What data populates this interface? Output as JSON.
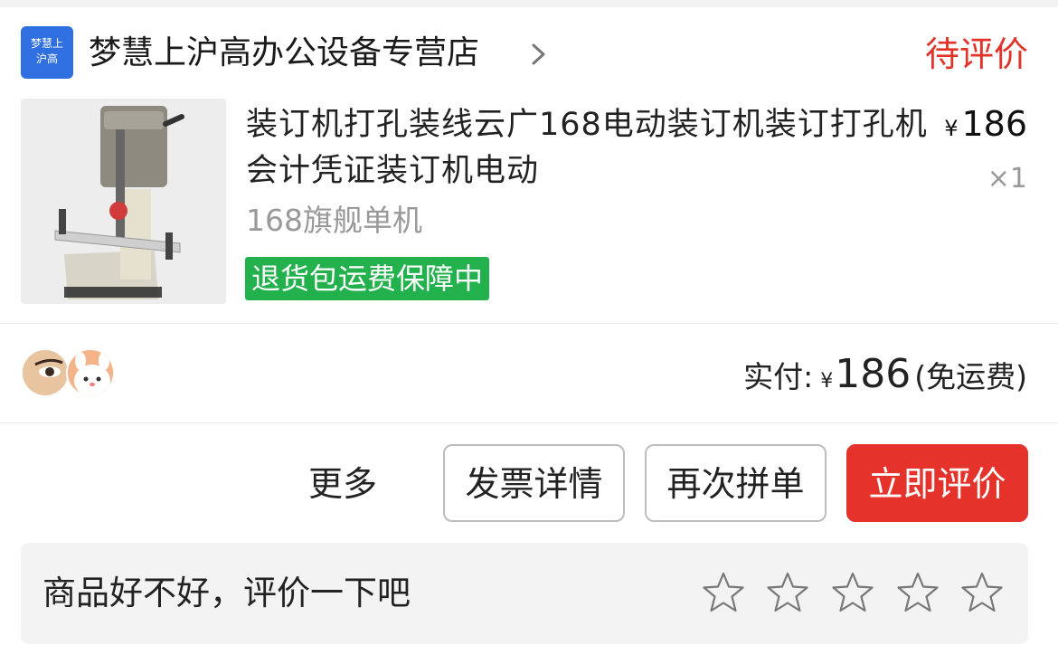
{
  "shop": {
    "logo_line1": "梦慧上",
    "logo_line2": "沪高",
    "name": "梦慧上沪高办公设备专营店",
    "chevron_icon": "chevron-right-icon"
  },
  "order": {
    "status": "待评价",
    "status_color": "#e0332a"
  },
  "product": {
    "title": "装订机打孔装线云广168电动装订机装订打孔机会计凭证装订机电动",
    "price_symbol": "¥",
    "price": "186",
    "quantity": "×1",
    "spec": "168旗舰单机",
    "guarantee": "退货包运费保障中",
    "guarantee_color": "#22b14c"
  },
  "payment": {
    "label": "实付:",
    "symbol": "¥",
    "amount": "186",
    "note": "(免运费)"
  },
  "actions": {
    "more": "更多",
    "invoice": "发票详情",
    "reorder": "再次拼单",
    "review": "立即评价",
    "review_color": "#e5322b"
  },
  "review_prompt": {
    "text": "商品好不好，评价一下吧",
    "stars": [
      "star-outline-icon",
      "star-outline-icon",
      "star-outline-icon",
      "star-outline-icon",
      "star-outline-icon"
    ]
  }
}
